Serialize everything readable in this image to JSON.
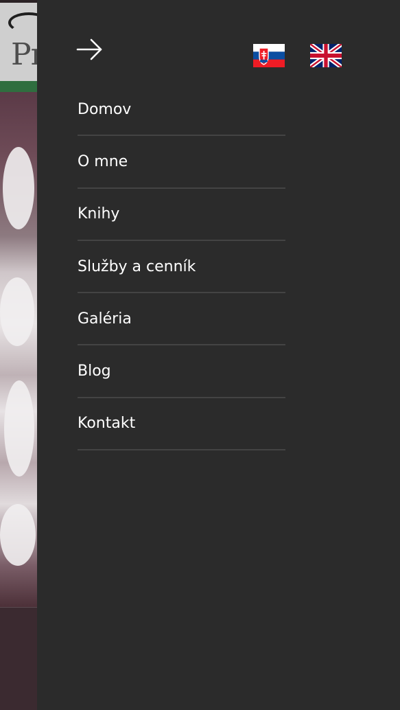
{
  "language_switcher": {
    "flags": [
      {
        "code": "sk",
        "icon": "slovak-flag-icon"
      },
      {
        "code": "en",
        "icon": "uk-flag-icon"
      }
    ]
  },
  "close_button": {
    "icon": "arrow-right-icon"
  },
  "menu": {
    "items": [
      {
        "label": "Domov"
      },
      {
        "label": "O mne"
      },
      {
        "label": "Knihy"
      },
      {
        "label": "Služby a cenník"
      },
      {
        "label": "Galéria"
      },
      {
        "label": "Blog"
      },
      {
        "label": "Kontakt"
      }
    ]
  },
  "background_page": {
    "logo_text": "Pro"
  },
  "colors": {
    "drawer_background": "#2b2b2b",
    "menu_text": "#ffffff",
    "divider": "#444444",
    "header_green": "#2f6e3f"
  }
}
